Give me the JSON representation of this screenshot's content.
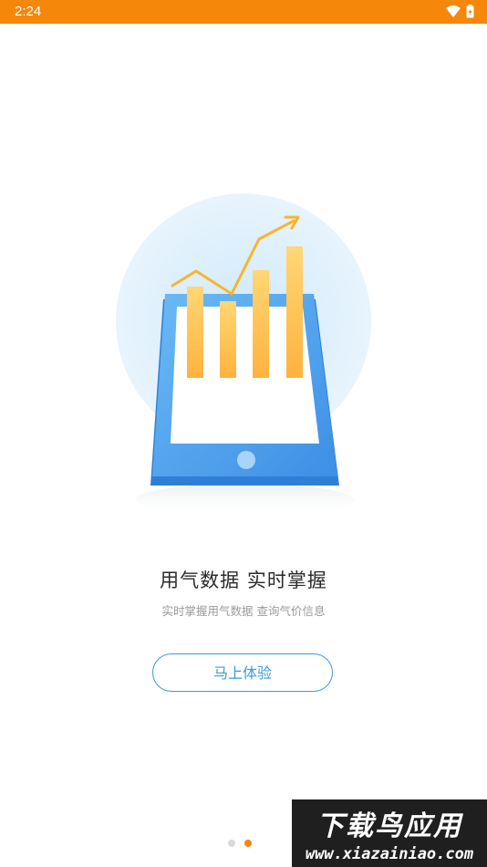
{
  "status_bar": {
    "time": "2:24",
    "icons": [
      "wifi-icon",
      "battery-icon"
    ],
    "color": "#f5870a"
  },
  "onboarding": {
    "headline": "用气数据  实时掌握",
    "subline": "实时掌握用气数据 查询气价信息",
    "cta_label": "马上体验",
    "page_count": 2,
    "active_page": 2
  },
  "watermark": {
    "line1": "下载鸟应用",
    "line2": "www.xiazainiao.com"
  },
  "colors": {
    "accent_orange": "#f5870a",
    "accent_blue": "#3a9be0",
    "tablet_blue": "#4da4ee",
    "bar_yellow": "#ffc24a"
  }
}
